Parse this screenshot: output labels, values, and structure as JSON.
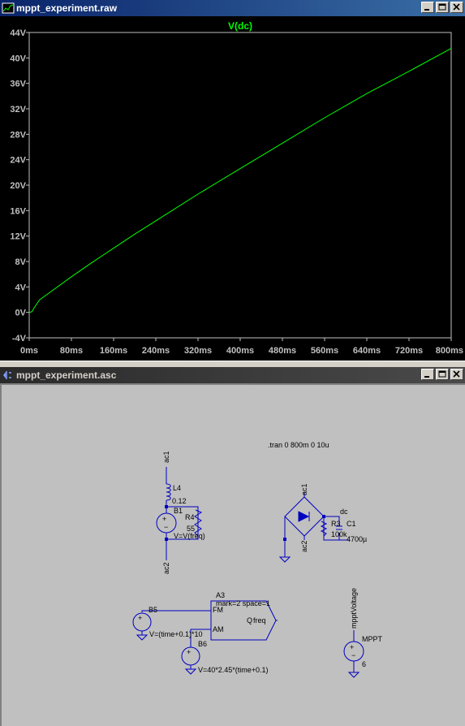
{
  "waveform_window": {
    "title": "mppt_experiment.raw",
    "trace_label": "V(dc)"
  },
  "schematic_window": {
    "title": "mppt_experiment.asc",
    "directive": ".tran 0 800m 0 10u",
    "labels": {
      "ac1_top": "ac1",
      "l4_name": "L4",
      "l4_value": "0.12",
      "b1_name": "B1",
      "r4_name": "R4",
      "r4_value": "55",
      "b1_value": "V=V(freq)",
      "ac2_bottom": "ac2",
      "ac1_bridge": "ac1",
      "ac2_bridge": "ac2",
      "dc_net": "dc",
      "r3_name": "R3",
      "r3_value": "100k",
      "c1_name": "C1",
      "c1_value": "4700µ",
      "a3_name": "A3",
      "a3_params": "mark=2 space=1",
      "a3_fm": "FM",
      "a3_am": "AM",
      "a3_q": "Q",
      "a3_freq": "freq",
      "b5_name": "B5",
      "b5_value": "V=(time+0.1)*10",
      "b6_name": "B6",
      "b6_value": "V=40*2.45*(time+0.1)",
      "mppt_net": "mpptVoltage",
      "mppt_name": "MPPT",
      "mppt_value": "6"
    }
  },
  "colors": {
    "trace": "#00ff00",
    "axis_text": "#c0c0c0",
    "wire": "#0000c0",
    "title_active": "#0a246a"
  },
  "chart_data": {
    "type": "line",
    "title": "V(dc)",
    "xlabel": "",
    "ylabel": "",
    "x_ticks": [
      "0ms",
      "80ms",
      "160ms",
      "240ms",
      "320ms",
      "400ms",
      "480ms",
      "560ms",
      "640ms",
      "720ms",
      "800ms"
    ],
    "y_ticks": [
      "-4V",
      "0V",
      "4V",
      "8V",
      "12V",
      "16V",
      "20V",
      "24V",
      "28V",
      "32V",
      "36V",
      "40V",
      "44V"
    ],
    "xlim": [
      0,
      800
    ],
    "ylim": [
      -4,
      44
    ],
    "grid": false,
    "series": [
      {
        "name": "V(dc)",
        "x": [
          0,
          5,
          10,
          20,
          40,
          80,
          120,
          160,
          200,
          240,
          320,
          400,
          480,
          560,
          640,
          720,
          800
        ],
        "y": [
          0,
          0.1,
          0.8,
          2.0,
          3.2,
          5.6,
          7.9,
          10.1,
          12.3,
          14.4,
          18.6,
          22.6,
          26.6,
          30.6,
          34.4,
          37.9,
          41.5
        ]
      }
    ]
  }
}
